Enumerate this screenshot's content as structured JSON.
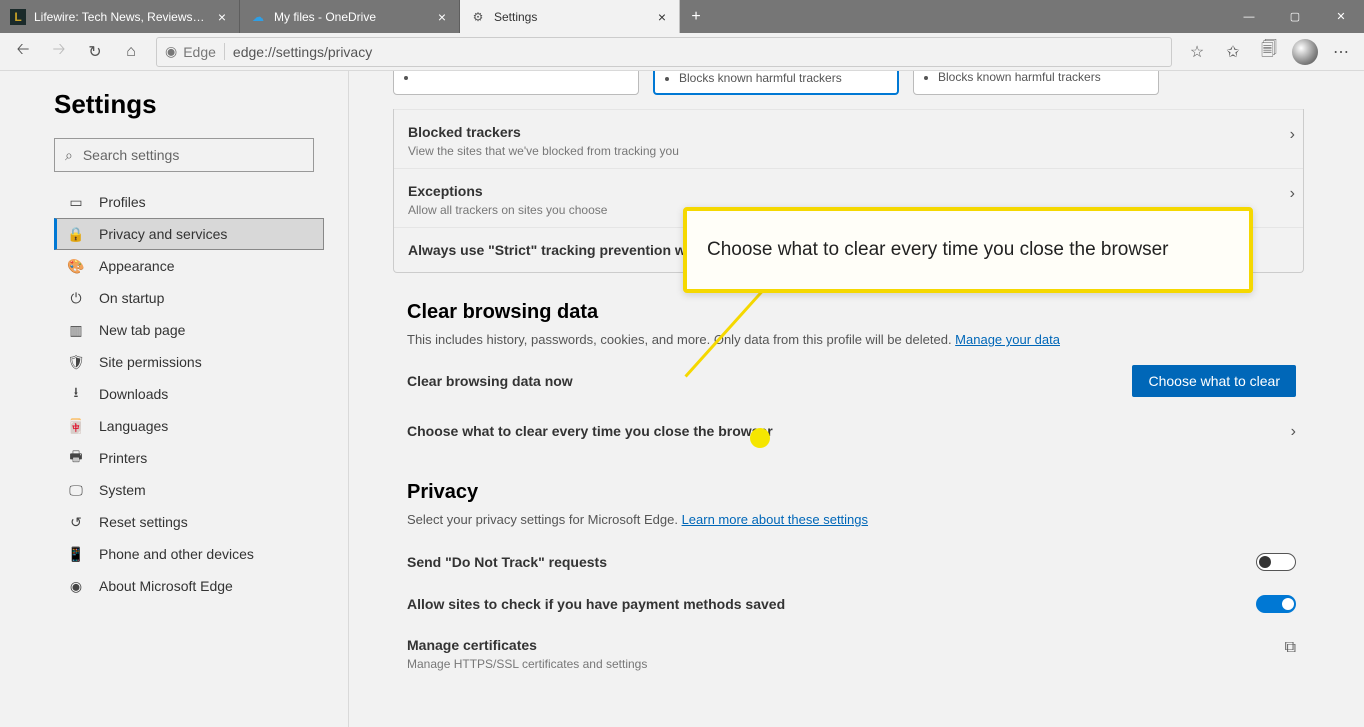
{
  "tabs": {
    "t0": {
      "title": "Lifewire: Tech News, Reviews, He"
    },
    "t1": {
      "title": "My files - OneDrive"
    },
    "t2": {
      "title": "Settings"
    }
  },
  "addr": {
    "label": "Edge",
    "url": "edge://settings/privacy"
  },
  "sidebar": {
    "heading": "Settings",
    "search_placeholder": "Search settings",
    "items": {
      "profiles": "Profiles",
      "privacy": "Privacy and services",
      "appearance": "Appearance",
      "startup": "On startup",
      "newtab": "New tab page",
      "siteperm": "Site permissions",
      "downloads": "Downloads",
      "languages": "Languages",
      "printers": "Printers",
      "system": "System",
      "reset": "Reset settings",
      "phone": "Phone and other devices",
      "about": "About Microsoft Edge"
    }
  },
  "tracking": {
    "card_bullet": "Blocks known harmful trackers",
    "blocked_title": "Blocked trackers",
    "blocked_sub": "View the sites that we've blocked from tracking you",
    "exceptions_title": "Exceptions",
    "exceptions_sub": "Allow all trackers on sites you choose",
    "strict_label": "Always use \"Strict\" tracking prevention whe"
  },
  "clear": {
    "heading": "Clear browsing data",
    "sub_prefix": "This includes history, passwords, cookies, and more. Only data from this profile will be deleted. ",
    "sub_link": "Manage your data",
    "now_label": "Clear browsing data now",
    "now_button": "Choose what to clear",
    "every_time": "Choose what to clear every time you close the browser"
  },
  "privacy": {
    "heading": "Privacy",
    "sub_prefix": "Select your privacy settings for Microsoft Edge. ",
    "sub_link": "Learn more about these settings",
    "dnt": "Send \"Do Not Track\" requests",
    "payment": "Allow sites to check if you have payment methods saved",
    "cert_title": "Manage certificates",
    "cert_sub": "Manage HTTPS/SSL certificates and settings"
  },
  "callout": {
    "text": "Choose what to clear every time you close the browser"
  }
}
